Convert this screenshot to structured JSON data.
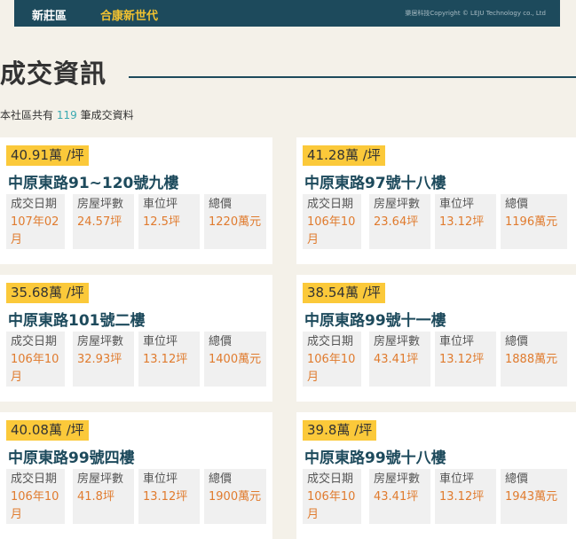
{
  "header": {
    "district": "新莊區",
    "community": "合康新世代",
    "copyright": "樂居科技Copyright © LEJU Technology co., Ltd"
  },
  "section": {
    "title": "成交資訊",
    "summary_prefix": "本社區共有",
    "count": "119",
    "summary_suffix": "筆成交資料"
  },
  "labels": {
    "date": "成交日期",
    "area": "房屋坪數",
    "parking": "車位坪",
    "total": "總價"
  },
  "cards": [
    {
      "price": "40.91萬 /坪",
      "address": "中原東路91~120號九樓",
      "date": "107年02月",
      "area": "24.57坪",
      "parking": "12.5坪",
      "total": "1220萬元"
    },
    {
      "price": "41.28萬 /坪",
      "address": "中原東路97號十八樓",
      "date": "106年10月",
      "area": "23.64坪",
      "parking": "13.12坪",
      "total": "1196萬元"
    },
    {
      "price": "35.68萬 /坪",
      "address": "中原東路101號二樓",
      "date": "106年10月",
      "area": "32.93坪",
      "parking": "13.12坪",
      "total": "1400萬元"
    },
    {
      "price": "38.54萬 /坪",
      "address": "中原東路99號十一樓",
      "date": "106年10月",
      "area": "43.41坪",
      "parking": "13.12坪",
      "total": "1888萬元"
    },
    {
      "price": "40.08萬 /坪",
      "address": "中原東路99號四樓",
      "date": "106年10月",
      "area": "41.8坪",
      "parking": "13.12坪",
      "total": "1900萬元"
    },
    {
      "price": "39.8萬 /坪",
      "address": "中原東路99號十八樓",
      "date": "106年10月",
      "area": "43.41坪",
      "parking": "13.12坪",
      "total": "1943萬元"
    }
  ]
}
